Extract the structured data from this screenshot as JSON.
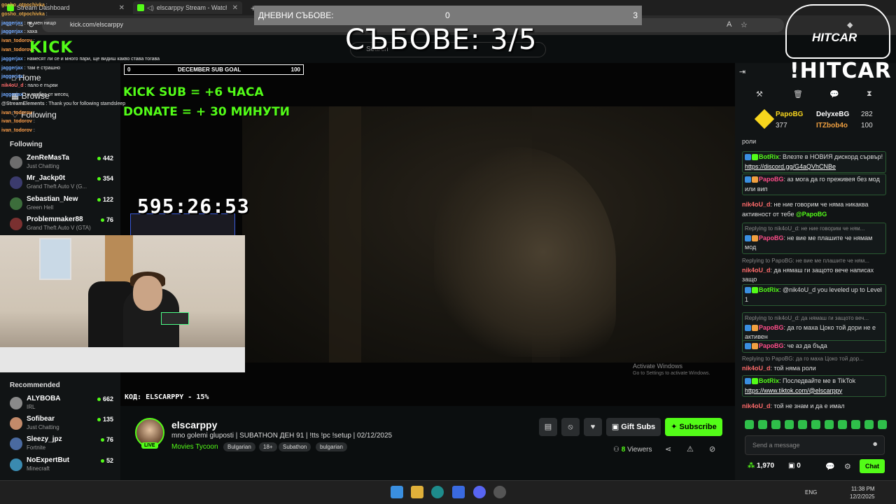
{
  "browser": {
    "tabs": [
      {
        "label": "Stream Dashboard",
        "active": false
      },
      {
        "label": "elscarppy Stream - Watch Li",
        "active": true
      }
    ],
    "new_tab": "+",
    "address": "kick.com/elscarppy"
  },
  "overlay_top": {
    "daily_label": "ДНЕВНИ СЪБОВЕ:",
    "daily_value": "0",
    "daily_goal": "3",
    "subs_banner": "СЪБОВЕ: 3/5"
  },
  "overlay_chat": [
    {
      "user": "gosho_otpochivka",
      "color": "#e6a84a",
      "text": ""
    },
    {
      "user": "gosho_otpochivka",
      "color": "#e6a84a",
      "text": ""
    },
    {
      "user": "jaggerjax",
      "color": "#6fa8ff",
      "text": "на мен нищо"
    },
    {
      "user": "jaggerjax",
      "color": "#6fa8ff",
      "text": "хаха"
    },
    {
      "user": "ivan_todorov",
      "color": "#ff9f4a",
      "text": ""
    },
    {
      "user": "ivan_todorov",
      "color": "#ff9f4a",
      "text": ""
    },
    {
      "user": "jaggerjax",
      "color": "#6fa8ff",
      "text": "намесят ли се и много пари, ще видиш какво става тогава"
    },
    {
      "user": "jaggerjax",
      "color": "#6fa8ff",
      "text": "там е страшно"
    },
    {
      "user": "jaggerjax",
      "color": "#6fa8ff",
      "text": ""
    },
    {
      "user": "nik4oU_d",
      "color": "#ff6b6b",
      "text": "пало е първи"
    },
    {
      "user": "jaggerjax",
      "color": "#6fa8ff",
      "text": "и трябва от месец"
    },
    {
      "user": "@StreamElements",
      "color": "#c8c8c8",
      "text": "Thank you for following stamdsleep"
    },
    {
      "user": "ivan_todorov",
      "color": "#ff9f4a",
      "text": ""
    },
    {
      "user": "ivan_todorov",
      "color": "#ff9f4a",
      "text": ""
    },
    {
      "user": "ivan_todorov",
      "color": "#ff9f4a",
      "text": ""
    }
  ],
  "kick": {
    "logo": "KICK",
    "search_placeholder": "Search"
  },
  "nav": {
    "home": "Home",
    "browse": "Browse",
    "following": "Following"
  },
  "following": {
    "title": "Following",
    "channels": [
      {
        "name": "ZenReMasTa",
        "category": "Just Chatting",
        "viewers": "442",
        "color": "#6d6d6d"
      },
      {
        "name": "Mr_Jackp0t",
        "category": "Grand Theft Auto V (G...",
        "viewers": "354",
        "color": "#3b3b6d"
      },
      {
        "name": "Sebastian_New",
        "category": "Green Hell",
        "viewers": "122",
        "color": "#3c6d3b"
      },
      {
        "name": "Problemmaker88",
        "category": "Grand Theft Auto V (GTA)",
        "viewers": "76",
        "color": "#7a3030"
      }
    ]
  },
  "recommended": {
    "title": "Recommended",
    "channels": [
      {
        "name": "ALYBOBA",
        "category": "IRL",
        "viewers": "662",
        "color": "#8a8a8a"
      },
      {
        "name": "Sofibear",
        "category": "Just Chatting",
        "viewers": "135",
        "color": "#c28a6a"
      },
      {
        "name": "Sleezy_jpz",
        "category": "Fortnite",
        "viewers": "76",
        "color": "#4a6aa0"
      },
      {
        "name": "NoExpertBut",
        "category": "Minecraft",
        "viewers": "52",
        "color": "#3a8ab0"
      }
    ]
  },
  "sub_goal": {
    "start": "0",
    "label": "DECEMBER SUB GOAL",
    "end": "100"
  },
  "promo_lines": [
    "KICK SUB = +6 ЧАСА",
    "DONATE = + 30 МИНУТИ"
  ],
  "timer": "595:26:53",
  "code_text": "КОД: ELSCARPPY - 15%",
  "activate_windows": {
    "title": "Activate Windows",
    "sub": "Go to Settings to activate Windows."
  },
  "stream": {
    "name": "elscarppy",
    "live_badge": "LIVE",
    "title": "mno golemi gluposti | SUBATHON ДЕН 91 | !tts !pc !setup | 02/12/2025",
    "category": "Movies Tycoon",
    "tags": [
      "Bulgarian",
      "18+",
      "Subathon",
      "bulgarian"
    ],
    "gift_label": "Gift Subs",
    "subscribe_label": "Subscribe",
    "viewers_count": "8",
    "viewers_label": "Viewers"
  },
  "hitcar": {
    "logo_text": "HITCAR",
    "command": "!HITCAR"
  },
  "top_gifters": [
    {
      "name": "PapoBG",
      "value": "377"
    },
    {
      "name": "DelyxeBG",
      "value": "282"
    },
    {
      "name": "ITZbob4o",
      "value": "100"
    }
  ],
  "chat_messages": [
    {
      "type": "plain",
      "user": "",
      "user_color": "#ddd",
      "text": "роли"
    },
    {
      "type": "boxed",
      "user": "BotRix",
      "user_color": "#53fc18",
      "text": "Влезте в НОВИЯ дискорд сървър!",
      "link": "https://discord.gg/G4aQVhCNBe"
    },
    {
      "type": "boxed",
      "user": "PapoBG",
      "user_color": "#ff4d8a",
      "text": "аз мога да го преживея без мод или вип"
    },
    {
      "type": "plain",
      "user": "nik4oU_d",
      "user_color": "#ff6b6b",
      "text": "не ние говорим че няма никаква активност от тебе",
      "mention": "@PapoBG"
    },
    {
      "type": "boxed",
      "reply": "Replying to nik4oU_d: не ние говорим че ням...",
      "user": "PapoBG",
      "user_color": "#ff4d8a",
      "text": "не вие ме плашите че нямам мод"
    },
    {
      "type": "plain",
      "reply": "Replying to PapoBG: не вие ме плашите че ням...",
      "user": "nik4oU_d",
      "user_color": "#ff6b6b",
      "text": "да нямаш ги защото вече написах защо"
    },
    {
      "type": "boxed",
      "user": "BotRix",
      "user_color": "#53fc18",
      "text": "@nik4oU_d you leveled up to Level 1"
    },
    {
      "type": "boxed",
      "reply": "Replying to nik4oU_d: да нямаш ги защото веч...",
      "user": "PapoBG",
      "user_color": "#ff4d8a",
      "text": "да го маха Цоко той дори не е активен"
    },
    {
      "type": "boxed",
      "user": "PapoBG",
      "user_color": "#ff4d8a",
      "text": "че аз да бъда"
    },
    {
      "type": "plain",
      "reply": "Replying to PapoBG: да го маха Цоко той дор...",
      "user": "nik4oU_d",
      "user_color": "#ff6b6b",
      "text": "той няма роли"
    },
    {
      "type": "boxed",
      "user": "BotRix",
      "user_color": "#53fc18",
      "text": "Последвайте ме в TikTok",
      "link": "https://www.tiktok.com/@elscarppy"
    },
    {
      "type": "plain",
      "user": "nik4oU_d",
      "user_color": "#ff6b6b",
      "text": "той не знам и да е имал"
    }
  ],
  "chat_input": {
    "placeholder": "Send a message",
    "points": "1,970",
    "points2": "0",
    "chat_button": "Chat"
  },
  "taskbar": {
    "lang": "ENG",
    "time": "11:38 PM",
    "date": "12/2/2025"
  }
}
